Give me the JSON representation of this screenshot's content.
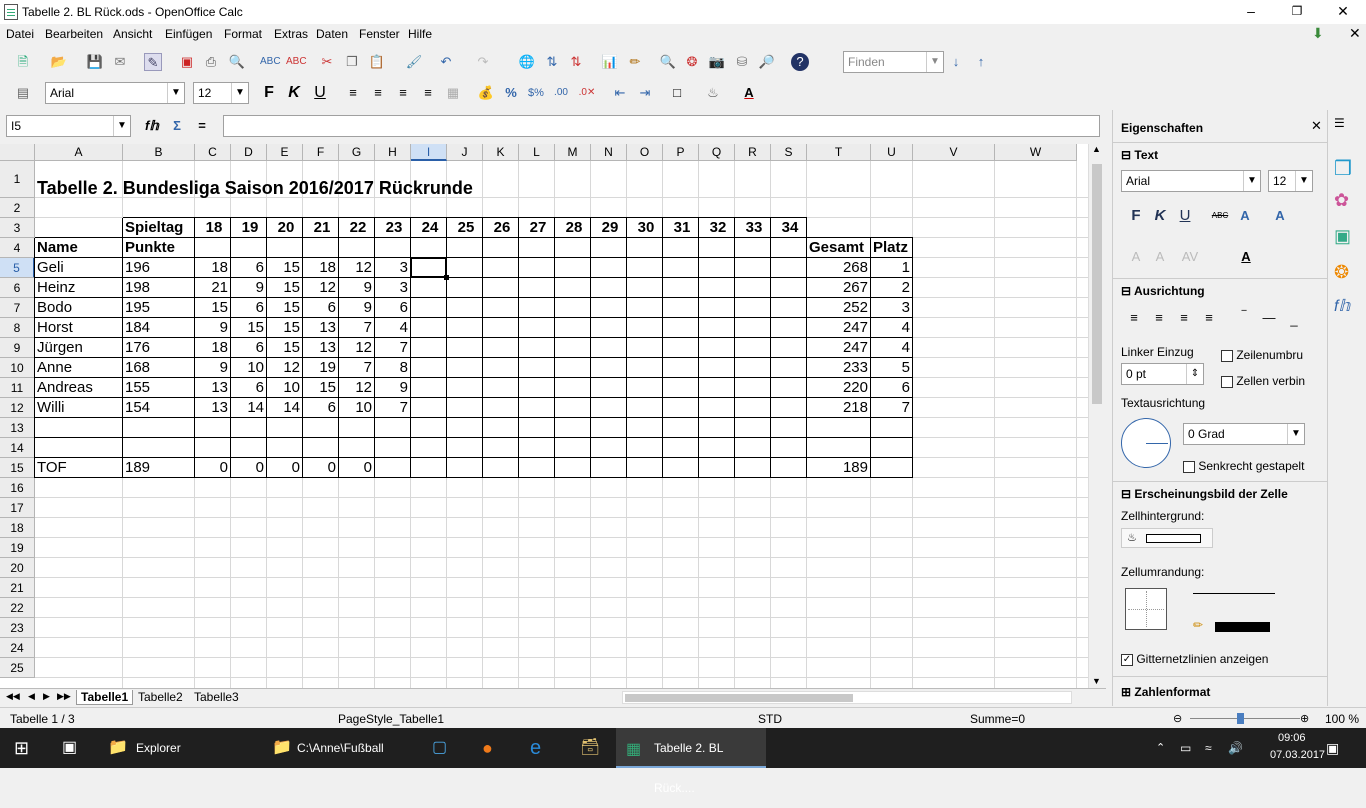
{
  "window": {
    "title": "Tabelle 2. BL Rück.ods - OpenOffice Calc"
  },
  "menu": [
    "Datei",
    "Bearbeiten",
    "Ansicht",
    "Einfügen",
    "Format",
    "Extras",
    "Daten",
    "Fenster",
    "Hilfe"
  ],
  "toolbar": {
    "find_placeholder": "Finden"
  },
  "formatting": {
    "font": "Arial",
    "size": "12"
  },
  "formula": {
    "name_box": "I5",
    "content": ""
  },
  "columns": [
    "A",
    "B",
    "C",
    "D",
    "E",
    "F",
    "G",
    "H",
    "I",
    "J",
    "K",
    "L",
    "M",
    "N",
    "O",
    "P",
    "Q",
    "R",
    "S",
    "T",
    "U",
    "V",
    "W"
  ],
  "rows": [
    "1",
    "2",
    "3",
    "4",
    "5",
    "6",
    "7",
    "8",
    "9",
    "10",
    "11",
    "12",
    "13",
    "14",
    "15",
    "16",
    "17",
    "18",
    "19",
    "20",
    "21",
    "22",
    "23",
    "24",
    "25"
  ],
  "sheet": {
    "title": "Tabelle 2. Bundesliga Saison 2016/2017 Rückrunde",
    "header_row3": {
      "B": "Spieltag",
      "days": [
        "18",
        "19",
        "20",
        "21",
        "22",
        "23",
        "24",
        "25",
        "26",
        "27",
        "28",
        "29",
        "30",
        "31",
        "32",
        "33",
        "34"
      ]
    },
    "header_row4": {
      "A": "Name",
      "B": "Punkte",
      "T": "Gesamt",
      "U": "Platz"
    },
    "data": [
      {
        "name": "Geli",
        "punkte": "196",
        "vals": [
          "18",
          "6",
          "15",
          "18",
          "12",
          "3"
        ],
        "gesamt": "268",
        "platz": "1"
      },
      {
        "name": "Heinz",
        "punkte": "198",
        "vals": [
          "21",
          "9",
          "15",
          "12",
          "9",
          "3"
        ],
        "gesamt": "267",
        "platz": "2"
      },
      {
        "name": "Bodo",
        "punkte": "195",
        "vals": [
          "15",
          "6",
          "15",
          "6",
          "9",
          "6"
        ],
        "gesamt": "252",
        "platz": "3"
      },
      {
        "name": "Horst",
        "punkte": "184",
        "vals": [
          "9",
          "15",
          "15",
          "13",
          "7",
          "4"
        ],
        "gesamt": "247",
        "platz": "4"
      },
      {
        "name": "Jürgen",
        "punkte": "176",
        "vals": [
          "18",
          "6",
          "15",
          "13",
          "12",
          "7"
        ],
        "gesamt": "247",
        "platz": "4"
      },
      {
        "name": "Anne",
        "punkte": "168",
        "vals": [
          "9",
          "10",
          "12",
          "19",
          "7",
          "8"
        ],
        "gesamt": "233",
        "platz": "5"
      },
      {
        "name": "Andreas",
        "punkte": "155",
        "vals": [
          "13",
          "6",
          "10",
          "15",
          "12",
          "9"
        ],
        "gesamt": "220",
        "platz": "6"
      },
      {
        "name": "Willi",
        "punkte": "154",
        "vals": [
          "13",
          "14",
          "14",
          "6",
          "10",
          "7"
        ],
        "gesamt": "218",
        "platz": "7"
      }
    ],
    "tof": {
      "name": "TOF",
      "punkte": "189",
      "vals": [
        "0",
        "0",
        "0",
        "0",
        "0"
      ],
      "gesamt": "189"
    }
  },
  "tabs": [
    "Tabelle1",
    "Tabelle2",
    "Tabelle3"
  ],
  "status": {
    "sheet": "Tabelle 1 / 3",
    "pagestyle": "PageStyle_Tabelle1",
    "mode": "STD",
    "sum": "Summe=0",
    "zoom": "100 %"
  },
  "sidebar": {
    "title": "Eigenschaften",
    "text_section": "Text",
    "font": "Arial",
    "size": "12",
    "align_section": "Ausrichtung",
    "indent_label": "Linker Einzug",
    "indent_value": "0 pt",
    "wrap_label": "Zeilenumbru",
    "merge_label": "Zellen verbin",
    "orientation_label": "Textausrichtung",
    "degree_value": "0 Grad",
    "stacked_label": "Senkrecht gestapelt",
    "appearance_section": "Erscheinungsbild der Zelle",
    "bg_label": "Zellhintergrund:",
    "border_label": "Zellumrandung:",
    "gridlines_label": "Gitternetzlinien anzeigen",
    "number_section": "Zahlenformat"
  },
  "taskbar": {
    "items": [
      "Explorer",
      "C:\\Anne\\Fußball",
      "Tabelle 2. BL Rück...."
    ],
    "time": "09:06",
    "date": "07.03.2017"
  }
}
